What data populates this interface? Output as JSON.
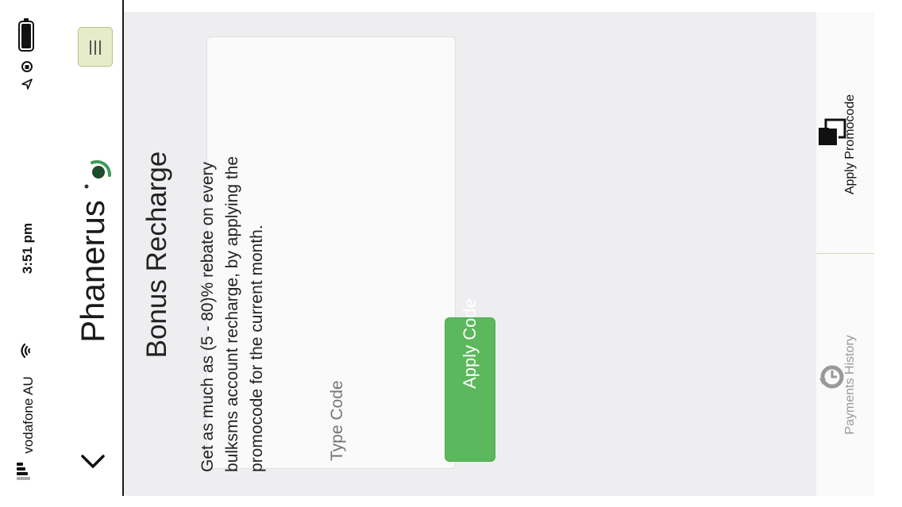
{
  "status": {
    "carrier": "vodafone AU",
    "time": "3:51 pm"
  },
  "header": {
    "title": "Phanerus"
  },
  "page": {
    "heading": "Bonus Recharge",
    "description": [
      "Get as much as (5 - 80)% rebate on every",
      "bulksms account recharge, by applying the",
      "promocode for the current month."
    ],
    "code_placeholder": "Type Code",
    "apply_button_label": "Apply Code"
  },
  "tabs": [
    {
      "label": "Apply Promocode",
      "icon": "documents-icon",
      "active": true
    },
    {
      "label": "Payments History",
      "icon": "history-icon",
      "active": false
    }
  ],
  "colors": {
    "accent": "#5cb85c",
    "menu_button": "#e6ecc9",
    "content_bg": "#eeeef0"
  }
}
